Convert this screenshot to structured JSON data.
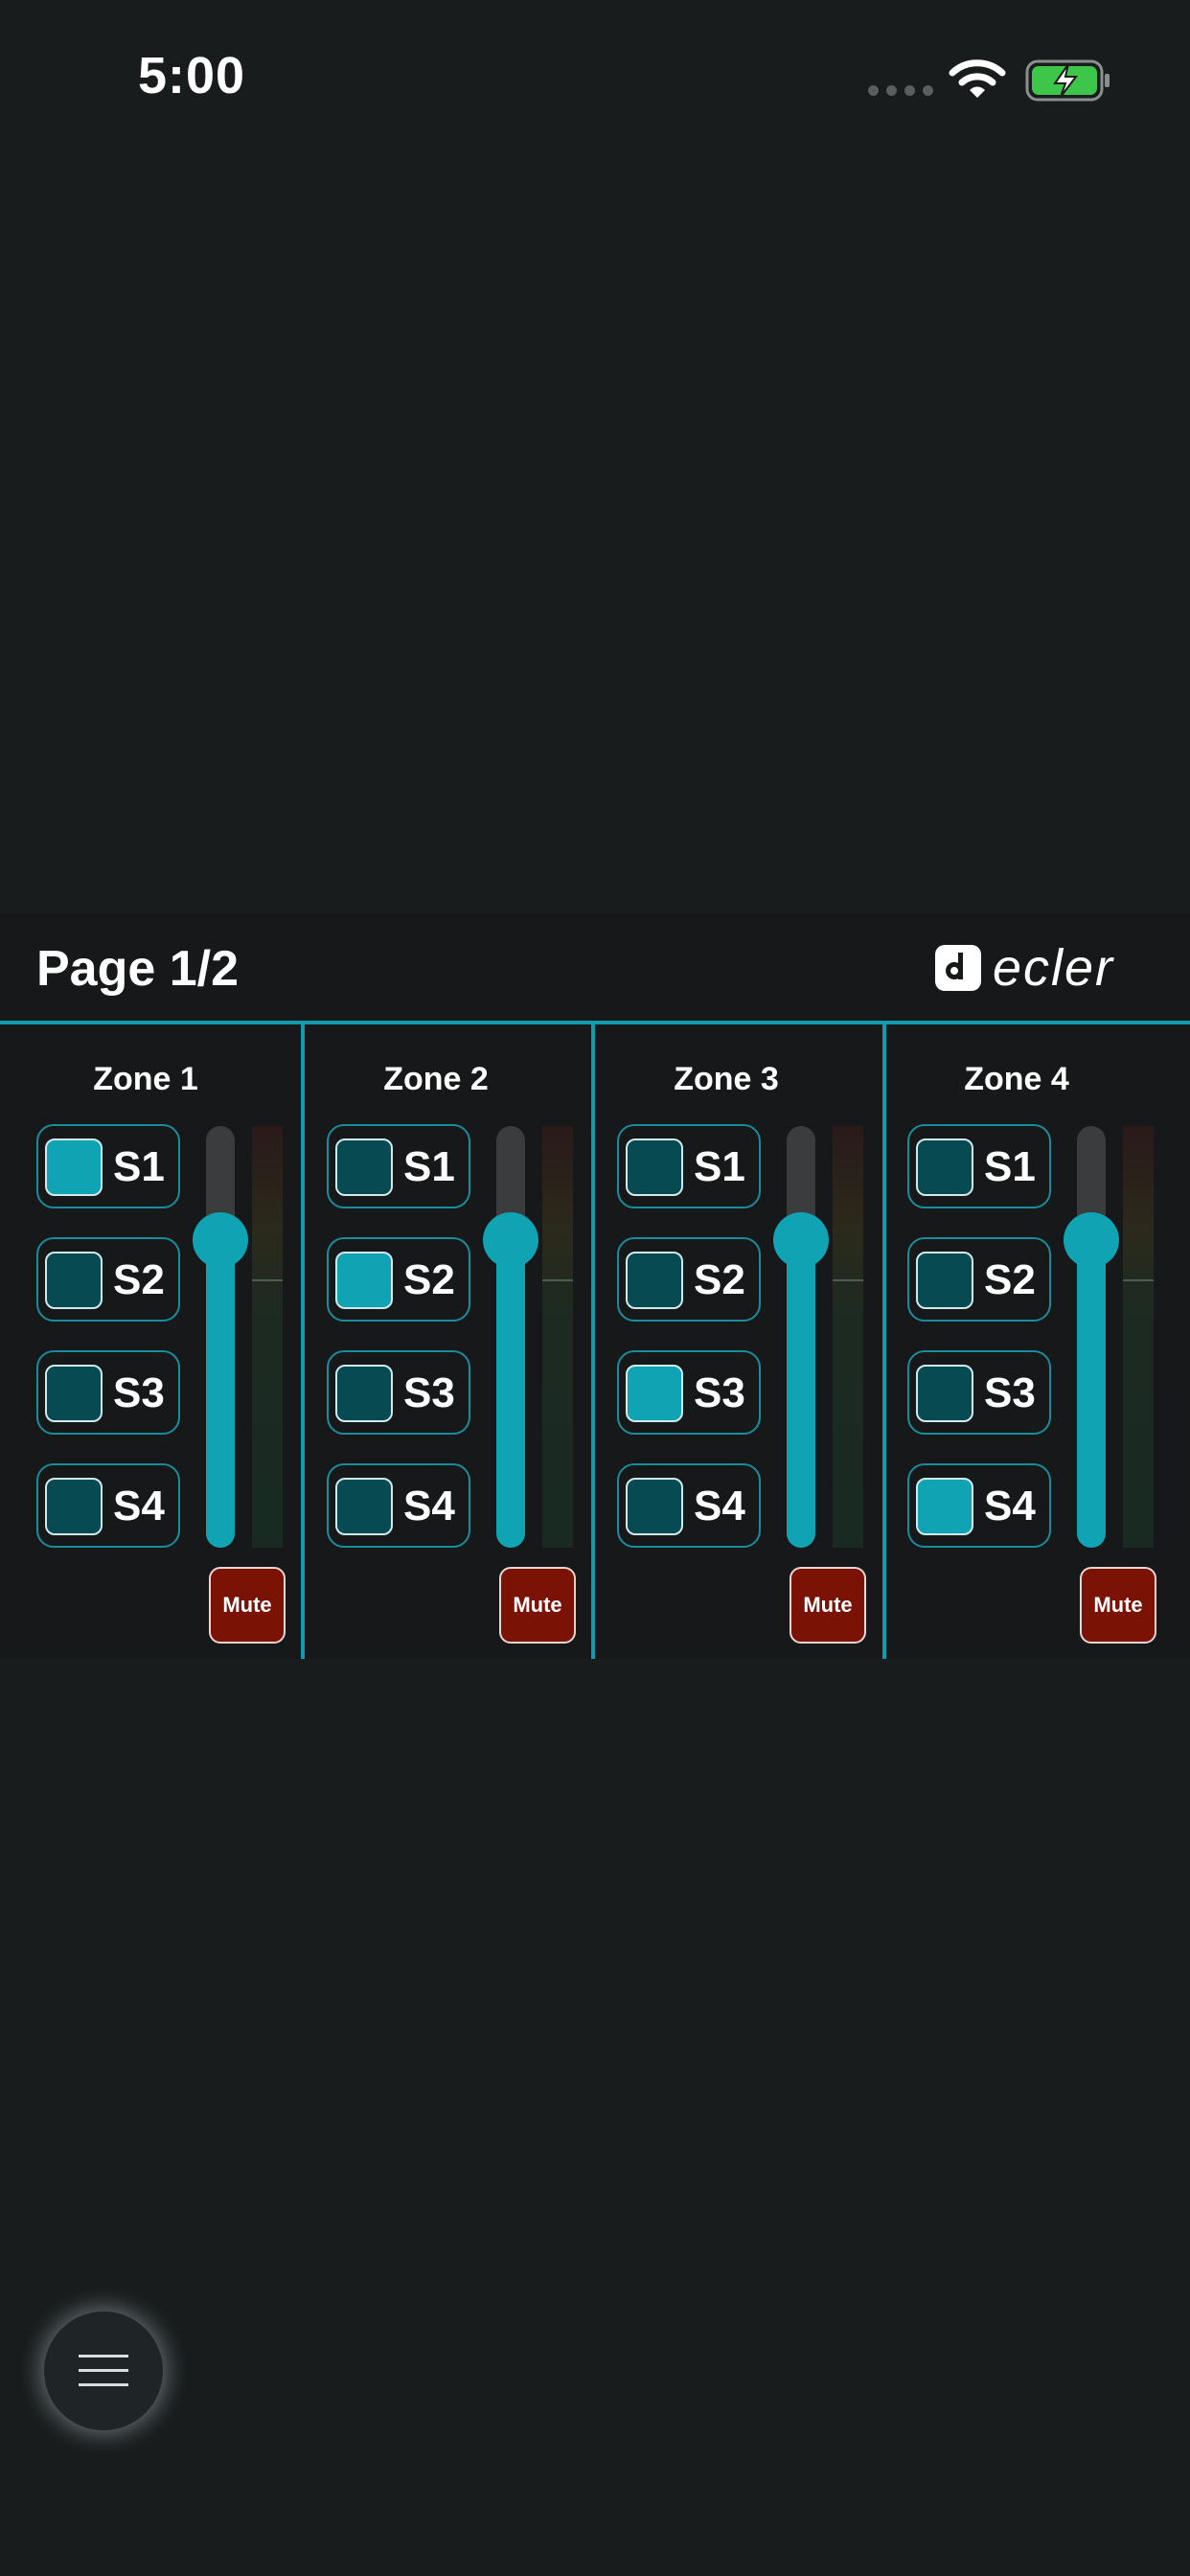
{
  "status_bar": {
    "time": "5:00"
  },
  "header": {
    "page_title": "Page 1/2",
    "logo_text": "ecler"
  },
  "zones": [
    {
      "name": "Zone 1",
      "sources": [
        "S1",
        "S2",
        "S3",
        "S4"
      ],
      "active_source": "S1",
      "mute_label": "Mute",
      "fader_level": 0.73
    },
    {
      "name": "Zone 2",
      "sources": [
        "S1",
        "S2",
        "S3",
        "S4"
      ],
      "active_source": "S2",
      "mute_label": "Mute",
      "fader_level": 0.73
    },
    {
      "name": "Zone 3",
      "sources": [
        "S1",
        "S2",
        "S3",
        "S4"
      ],
      "active_source": "S3",
      "mute_label": "Mute",
      "fader_level": 0.73
    },
    {
      "name": "Zone 4",
      "sources": [
        "S1",
        "S2",
        "S3",
        "S4"
      ],
      "active_source": "S4",
      "mute_label": "Mute",
      "fader_level": 0.73
    }
  ],
  "colors": {
    "accent": "#10a3b4",
    "mute": "#7b1206",
    "background": "#191c1d",
    "panel": "#161819"
  },
  "icons": {
    "menu": "hamburger-menu-icon",
    "wifi": "wifi-icon",
    "battery": "battery-charging-icon",
    "logo": "ecler-logo-icon"
  }
}
